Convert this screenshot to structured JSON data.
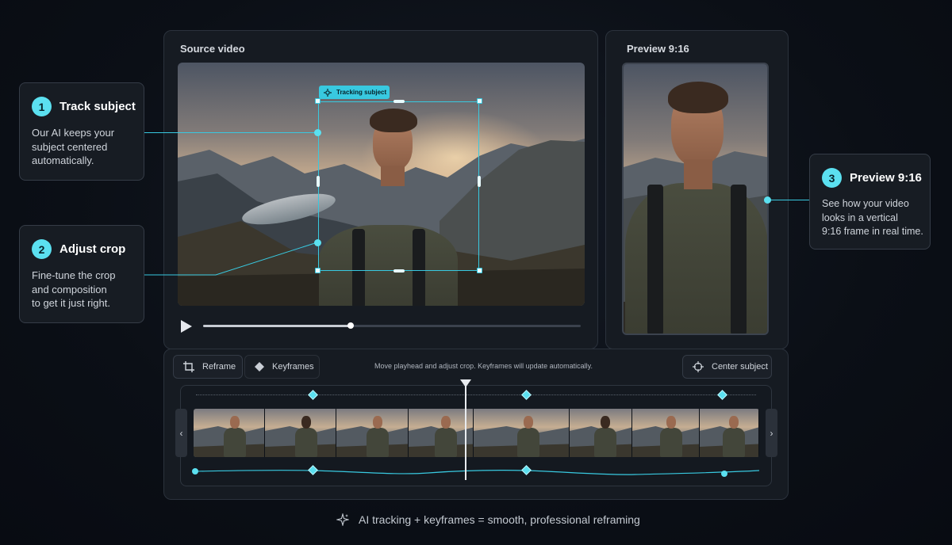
{
  "source_panel": {
    "title": "Source video"
  },
  "preview_panel": {
    "title": "Preview 9:16"
  },
  "tracking_tag": {
    "label": "Tracking subject",
    "icon": "tracking-icon"
  },
  "playback": {
    "progress": 0.39,
    "play_icon": "play-icon"
  },
  "callouts": [
    {
      "number": "1",
      "title": "Track subject",
      "desc_lines": [
        "Our AI keeps your",
        "subject centered",
        "automatically."
      ]
    },
    {
      "number": "2",
      "title": "Adjust crop",
      "desc_lines": [
        "Fine-tune the crop",
        "and composition",
        "to get it just right."
      ]
    },
    {
      "number": "3",
      "title": "Preview 9:16",
      "desc_lines": [
        "See how your video",
        "looks in a vertical",
        "9:16 frame in real time."
      ]
    }
  ],
  "toolbar": {
    "reframe_label": "Reframe",
    "keyframes_label": "Keyframes",
    "hint": "Move playhead and adjust crop. Keyframes will update automatically.",
    "center_label": "Center subject"
  },
  "timeline": {
    "prev_icon": "chevron-left-icon",
    "next_icon": "chevron-right-icon",
    "keyframe_positions": [
      0.21,
      0.59,
      0.94
    ],
    "playhead_position": 0.48
  },
  "footer": {
    "text": "AI tracking + keyframes = smooth, professional reframing",
    "icon": "sparkle-icon"
  },
  "colors": {
    "accent": "#38c9e0",
    "accent_light": "#5be0f0",
    "background": "#0b0f16",
    "panel": "#161b22"
  }
}
